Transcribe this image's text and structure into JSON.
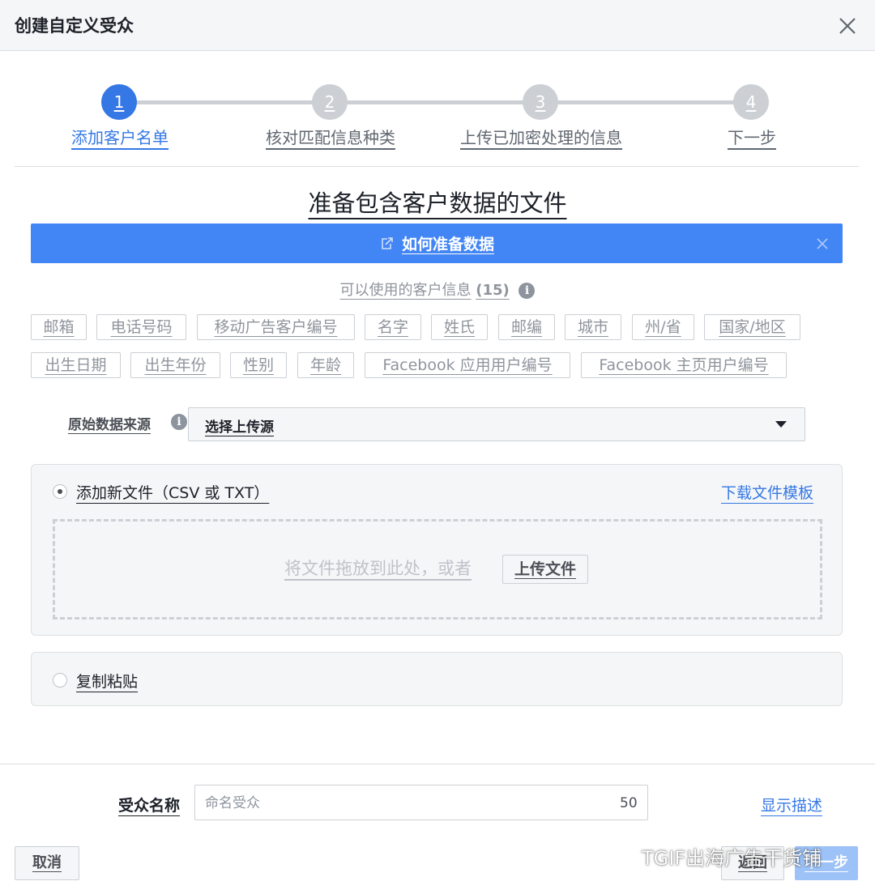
{
  "dialog": {
    "title": "创建自定义受众"
  },
  "steps": [
    {
      "number": "1",
      "label": "添加客户名单",
      "active": true
    },
    {
      "number": "2",
      "label": "核对匹配信息种类",
      "active": false
    },
    {
      "number": "3",
      "label": "上传已加密处理的信息",
      "active": false
    },
    {
      "number": "4",
      "label": "下一步",
      "active": false
    }
  ],
  "section_title": "准备包含客户数据的文件",
  "banner": {
    "link": "如何准备数据",
    "color": "#4285f4"
  },
  "fields": {
    "title": "可以使用的客户信息",
    "count": "(15)",
    "tags_row1": [
      "邮箱",
      "电话号码",
      "移动广告客户编号",
      "名字",
      "姓氏",
      "邮编",
      "城市",
      "州/省",
      "国家/地区"
    ],
    "tags_row2": [
      "出生日期",
      "出生年份",
      "性别",
      "年龄",
      "Facebook 应用用户编号",
      "Facebook 主页用户编号"
    ]
  },
  "source": {
    "label": "原始数据来源",
    "selected": "选择上传源"
  },
  "upload": {
    "add_file_label": "添加新文件（CSV 或 TXT）",
    "template_link": "下载文件模板",
    "drop_text": "将文件拖放到此处，或者",
    "upload_button": "上传文件",
    "paste_label": "复制粘贴",
    "selected_option": "add_file"
  },
  "footer": {
    "name_label": "受众名称",
    "name_placeholder": "命名受众",
    "name_value": "",
    "char_count": "50",
    "show_description": "显示描述",
    "cancel": "取消",
    "back": "返回",
    "next": "下一步"
  },
  "watermark": "TGIF出海广告干货铺",
  "colors": {
    "accent": "#3578e5",
    "inactive_step": "#ccd0d5"
  }
}
